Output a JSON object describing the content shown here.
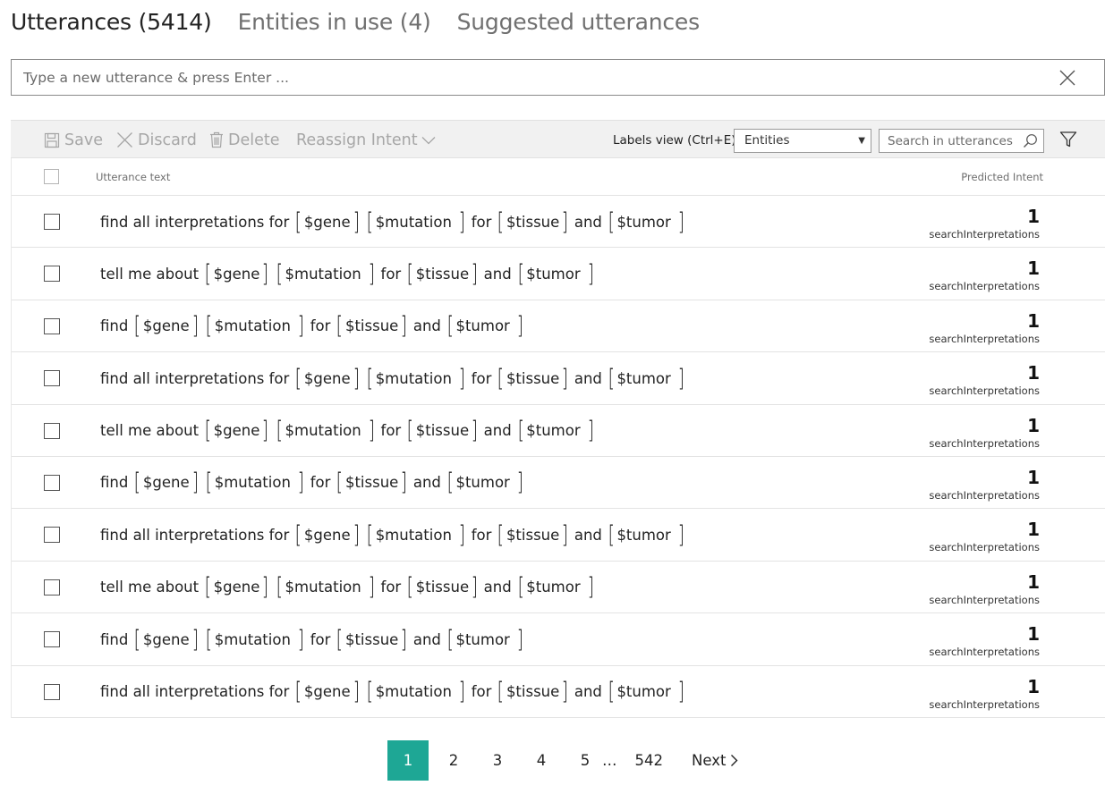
{
  "tabs": [
    {
      "label": "Utterances (5414)",
      "active": true
    },
    {
      "label": "Entities in use (4)",
      "active": false
    },
    {
      "label": "Suggested utterances",
      "active": false
    }
  ],
  "new_utterance": {
    "placeholder": "Type a new utterance & press Enter ...",
    "value": ""
  },
  "toolbar": {
    "save_label": "Save",
    "discard_label": "Discard",
    "delete_label": "Delete",
    "reassign_label": "Reassign Intent",
    "labels_view_label": "Labels view (Ctrl+E):",
    "labels_view_value": "Entities",
    "search_placeholder": "Search in utterances ..."
  },
  "table": {
    "col_utterance": "Utterance text",
    "col_intent": "Predicted Intent",
    "rows": [
      {
        "tokens": [
          {
            "t": "w",
            "v": "find all interpretations for"
          },
          {
            "t": "e",
            "v": "$gene"
          },
          {
            "t": "e",
            "v": "$mutation "
          },
          {
            "t": "w",
            "v": "for"
          },
          {
            "t": "e",
            "v": "$tissue"
          },
          {
            "t": "w",
            "v": "and"
          },
          {
            "t": "e",
            "v": "$tumor "
          }
        ],
        "score": "1",
        "intent": "searchInterpretations"
      },
      {
        "tokens": [
          {
            "t": "w",
            "v": "tell me about"
          },
          {
            "t": "e",
            "v": "$gene"
          },
          {
            "t": "e",
            "v": "$mutation "
          },
          {
            "t": "w",
            "v": "for"
          },
          {
            "t": "e",
            "v": "$tissue"
          },
          {
            "t": "w",
            "v": "and"
          },
          {
            "t": "e",
            "v": "$tumor "
          }
        ],
        "score": "1",
        "intent": "searchInterpretations"
      },
      {
        "tokens": [
          {
            "t": "w",
            "v": "find"
          },
          {
            "t": "e",
            "v": "$gene"
          },
          {
            "t": "e",
            "v": "$mutation "
          },
          {
            "t": "w",
            "v": "for"
          },
          {
            "t": "e",
            "v": "$tissue"
          },
          {
            "t": "w",
            "v": "and"
          },
          {
            "t": "e",
            "v": "$tumor "
          }
        ],
        "score": "1",
        "intent": "searchInterpretations"
      },
      {
        "tokens": [
          {
            "t": "w",
            "v": "find all interpretations for"
          },
          {
            "t": "e",
            "v": "$gene"
          },
          {
            "t": "e",
            "v": "$mutation "
          },
          {
            "t": "w",
            "v": "for"
          },
          {
            "t": "e",
            "v": "$tissue"
          },
          {
            "t": "w",
            "v": "and"
          },
          {
            "t": "e",
            "v": "$tumor "
          }
        ],
        "score": "1",
        "intent": "searchInterpretations"
      },
      {
        "tokens": [
          {
            "t": "w",
            "v": "tell me about"
          },
          {
            "t": "e",
            "v": "$gene"
          },
          {
            "t": "e",
            "v": "$mutation "
          },
          {
            "t": "w",
            "v": "for"
          },
          {
            "t": "e",
            "v": "$tissue"
          },
          {
            "t": "w",
            "v": "and"
          },
          {
            "t": "e",
            "v": "$tumor "
          }
        ],
        "score": "1",
        "intent": "searchInterpretations"
      },
      {
        "tokens": [
          {
            "t": "w",
            "v": "find"
          },
          {
            "t": "e",
            "v": "$gene"
          },
          {
            "t": "e",
            "v": "$mutation "
          },
          {
            "t": "w",
            "v": "for"
          },
          {
            "t": "e",
            "v": "$tissue"
          },
          {
            "t": "w",
            "v": "and"
          },
          {
            "t": "e",
            "v": "$tumor "
          }
        ],
        "score": "1",
        "intent": "searchInterpretations"
      },
      {
        "tokens": [
          {
            "t": "w",
            "v": "find all interpretations for"
          },
          {
            "t": "e",
            "v": "$gene"
          },
          {
            "t": "e",
            "v": "$mutation "
          },
          {
            "t": "w",
            "v": "for"
          },
          {
            "t": "e",
            "v": "$tissue"
          },
          {
            "t": "w",
            "v": "and"
          },
          {
            "t": "e",
            "v": "$tumor "
          }
        ],
        "score": "1",
        "intent": "searchInterpretations"
      },
      {
        "tokens": [
          {
            "t": "w",
            "v": "tell me about"
          },
          {
            "t": "e",
            "v": "$gene"
          },
          {
            "t": "e",
            "v": "$mutation "
          },
          {
            "t": "w",
            "v": "for"
          },
          {
            "t": "e",
            "v": "$tissue"
          },
          {
            "t": "w",
            "v": "and"
          },
          {
            "t": "e",
            "v": "$tumor "
          }
        ],
        "score": "1",
        "intent": "searchInterpretations"
      },
      {
        "tokens": [
          {
            "t": "w",
            "v": "find"
          },
          {
            "t": "e",
            "v": "$gene"
          },
          {
            "t": "e",
            "v": "$mutation "
          },
          {
            "t": "w",
            "v": "for"
          },
          {
            "t": "e",
            "v": "$tissue"
          },
          {
            "t": "w",
            "v": "and"
          },
          {
            "t": "e",
            "v": "$tumor "
          }
        ],
        "score": "1",
        "intent": "searchInterpretations"
      },
      {
        "tokens": [
          {
            "t": "w",
            "v": "find all interpretations for"
          },
          {
            "t": "e",
            "v": "$gene"
          },
          {
            "t": "e",
            "v": "$mutation "
          },
          {
            "t": "w",
            "v": "for"
          },
          {
            "t": "e",
            "v": "$tissue"
          },
          {
            "t": "w",
            "v": "and"
          },
          {
            "t": "e",
            "v": "$tumor "
          }
        ],
        "score": "1",
        "intent": "searchInterpretations"
      }
    ]
  },
  "pagination": {
    "pages": [
      "1",
      "2",
      "3",
      "4",
      "5"
    ],
    "ellipsis": "…",
    "last_page": "542",
    "next_label": "Next",
    "current": "1"
  },
  "colors": {
    "accent": "#1ea795",
    "toolbar_bg": "#f1f1f1",
    "disabled_text": "#a6a6a6"
  },
  "icons": {
    "clear": "close-icon",
    "save": "save-icon",
    "discard": "close-icon",
    "delete": "trash-icon",
    "reassign": "chevron-down-icon",
    "search": "search-icon",
    "filter": "filter-icon",
    "next": "chevron-right-icon"
  }
}
